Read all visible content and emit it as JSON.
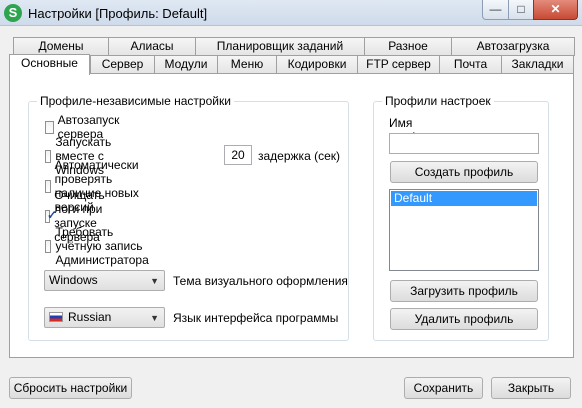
{
  "window": {
    "title": "Настройки [Профиль: Default]",
    "icon_letter": "S"
  },
  "tabs_row_back": [
    {
      "label": "Домены"
    },
    {
      "label": "Алиасы"
    },
    {
      "label": "Планировщик заданий"
    },
    {
      "label": "Разное"
    },
    {
      "label": "Автозагрузка"
    }
  ],
  "tabs_row_front": [
    {
      "label": "Основные",
      "active": true
    },
    {
      "label": "Сервер"
    },
    {
      "label": "Модули"
    },
    {
      "label": "Меню"
    },
    {
      "label": "Кодировки"
    },
    {
      "label": "FTP сервер"
    },
    {
      "label": "Почта"
    },
    {
      "label": "Закладки"
    }
  ],
  "general": {
    "legend": "Профиле-независимые настройки",
    "autostart_label": "Автозапуск сервера",
    "autostart_checked": false,
    "with_windows_label": "Запускать вместе с Windows",
    "with_windows_checked": false,
    "delay_value": "20",
    "delay_label": "задержка (сек)",
    "check_updates_label": "Автоматически проверять наличие новых версий",
    "check_updates_checked": false,
    "clear_logs_label": "Очищать логи при запуске сервера",
    "clear_logs_checked": true,
    "require_admin_label": "Требовать учётную запись Администратора",
    "require_admin_checked": false,
    "theme_value": "Windows",
    "theme_label": "Тема визуального оформления",
    "language_value": "Russian",
    "language_label": "Язык интерфейса программы"
  },
  "profiles": {
    "legend": "Профили настроек",
    "name_label": "Имя профиля",
    "name_value": "",
    "create_button": "Создать профиль",
    "items": [
      "Default"
    ],
    "load_button": "Загрузить профиль",
    "delete_button": "Удалить профиль"
  },
  "footer": {
    "reset_button": "Сбросить настройки",
    "save_button": "Сохранить",
    "close_button": "Закрыть"
  }
}
